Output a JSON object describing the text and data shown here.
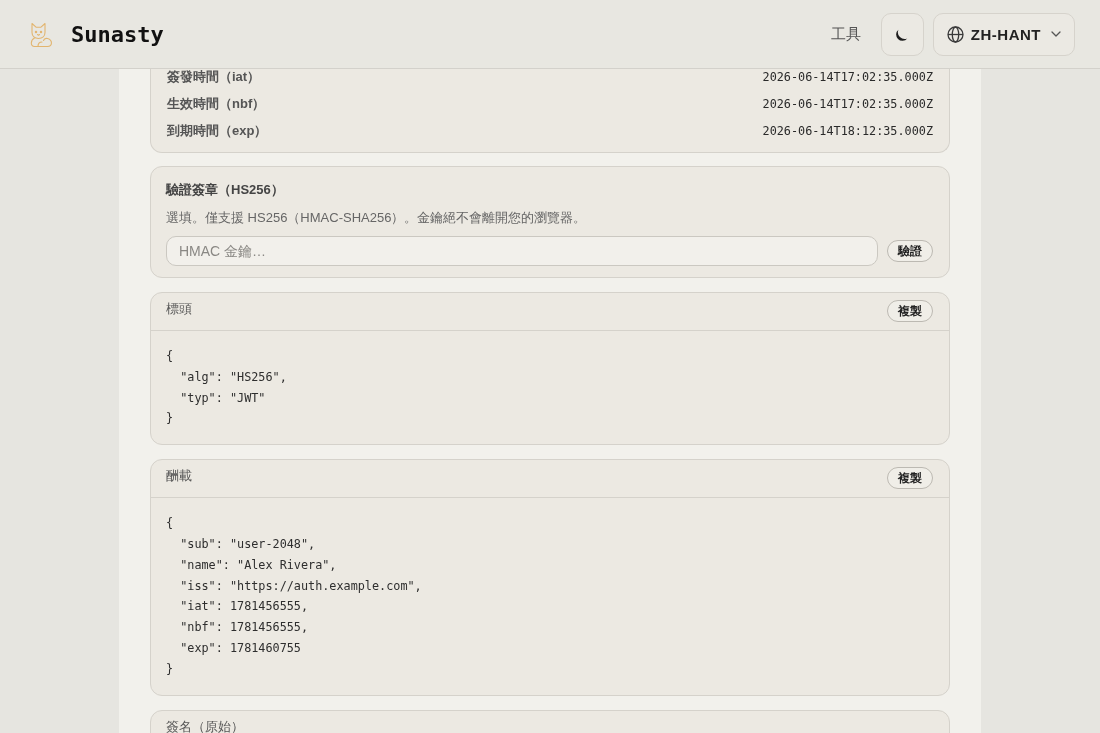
{
  "header": {
    "brand": "Sunasty",
    "nav_link": "工具",
    "language": "ZH-HANT"
  },
  "claims": [
    {
      "label": "簽發時間（iat）",
      "value": "2026-06-14T17:02:35.000Z"
    },
    {
      "label": "生效時間（nbf）",
      "value": "2026-06-14T17:02:35.000Z"
    },
    {
      "label": "到期時間（exp）",
      "value": "2026-06-14T18:12:35.000Z"
    }
  ],
  "verify": {
    "title": "驗證簽章（HS256）",
    "description": "選填。僅支援 HS256（HMAC-SHA256）。金鑰絕不會離開您的瀏覽器。",
    "key_field": {
      "placeholder": "HMAC 金鑰…"
    },
    "button": "驗證"
  },
  "panels": [
    {
      "title": "標頭",
      "copy_button": "複製",
      "code": [
        "{",
        "  \"alg\": \"HS256\",",
        "  \"typ\": \"JWT\"",
        "}"
      ]
    },
    {
      "title": "酬載",
      "copy_button": "複製",
      "code": [
        "{",
        "  \"sub\": \"user-2048\",",
        "  \"name\": \"Alex Rivera\",",
        "  \"iss\": \"https://auth.example.com\",",
        "  \"iat\": 1781456555,",
        "  \"nbf\": 1781456555,",
        "  \"exp\": 1781460755",
        "}"
      ]
    },
    {
      "title": "簽名（原始）"
    }
  ]
}
